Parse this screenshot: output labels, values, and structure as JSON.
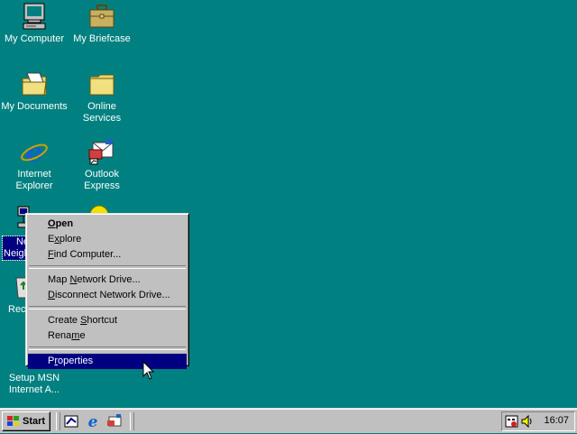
{
  "desktop": {
    "icons": [
      {
        "name": "my-computer",
        "label": "My Computer"
      },
      {
        "name": "my-briefcase",
        "label": "My Briefcase"
      },
      {
        "name": "my-documents",
        "label": "My Documents"
      },
      {
        "name": "online-services",
        "label": "Online Services"
      },
      {
        "name": "internet-explorer",
        "label": "Internet Explorer"
      },
      {
        "name": "outlook-express",
        "label": "Outlook Express"
      },
      {
        "name": "network-neighborhood",
        "label": "Ne Neigh"
      },
      {
        "name": "recycle-bin",
        "label": "Rec"
      },
      {
        "name": "setup-msn",
        "label": "Setup MSN Internet A..."
      }
    ]
  },
  "context_menu": {
    "items": [
      {
        "label": "Open",
        "accel": "O"
      },
      {
        "label": "Explore",
        "accel": "x"
      },
      {
        "label": "Find Computer...",
        "accel": "F"
      },
      {
        "label": "Map Network Drive...",
        "accel": "N"
      },
      {
        "label": "Disconnect Network Drive...",
        "accel": "D"
      },
      {
        "label": "Create Shortcut",
        "accel": "S"
      },
      {
        "label": "Rename",
        "accel": "m"
      },
      {
        "label": "Properties",
        "accel": "r"
      }
    ]
  },
  "taskbar": {
    "start_label": "Start",
    "clock": "16:07"
  },
  "colors": {
    "desktop": "#008080",
    "highlight": "#000080",
    "face": "#c0c0c0"
  }
}
